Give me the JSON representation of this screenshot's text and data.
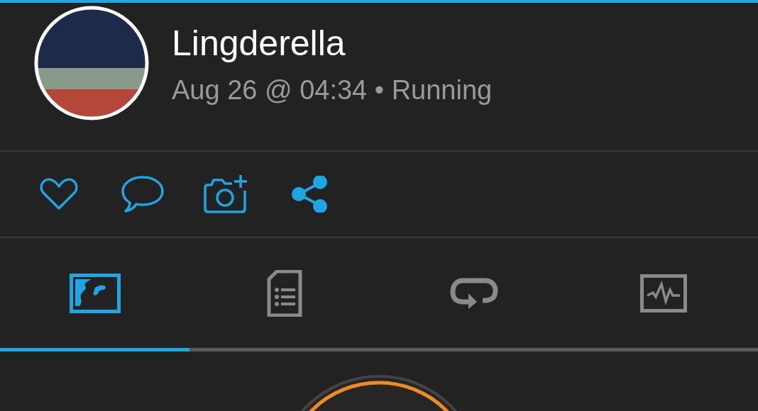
{
  "activity": {
    "user": "Lingderella",
    "subtitle": "Aug 26 @ 04:34 • Running"
  },
  "actions": [
    {
      "kind": "like"
    },
    {
      "kind": "comment"
    },
    {
      "kind": "photo"
    },
    {
      "kind": "share"
    }
  ],
  "tabs": [
    {
      "kind": "map",
      "selected": true
    },
    {
      "kind": "details",
      "selected": false
    },
    {
      "kind": "laps",
      "selected": false
    },
    {
      "kind": "chart",
      "selected": false
    }
  ]
}
